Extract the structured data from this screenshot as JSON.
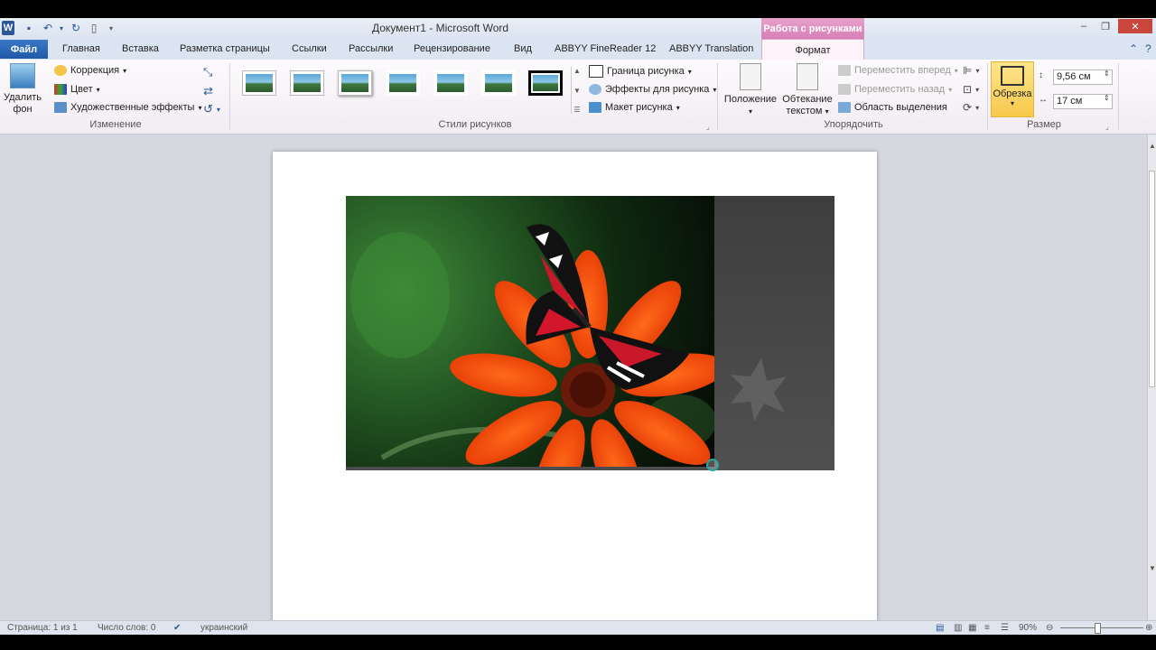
{
  "titlebar": {
    "title": "Документ1 - Microsoft Word",
    "context_group": "Работа с рисунками",
    "word_icon": "W"
  },
  "tabs": {
    "file": "Файл",
    "home": "Главная",
    "insert": "Вставка",
    "layout": "Разметка страницы",
    "references": "Ссылки",
    "mailings": "Рассылки",
    "review": "Рецензирование",
    "view": "Вид",
    "abbyy_fr": "ABBYY FineReader 12",
    "abbyy_tr": "ABBYY Translation",
    "format": "Формат"
  },
  "ribbon": {
    "remove_bg_line1": "Удалить",
    "remove_bg_line2": "фон",
    "correction": "Коррекция",
    "color": "Цвет",
    "artistic": "Художественные эффекты",
    "group_adjust": "Изменение",
    "group_styles": "Стили рисунков",
    "border": "Граница рисунка",
    "effects": "Эффекты для рисунка",
    "layout": "Макет рисунка",
    "position_line1": "Положение",
    "wrap_line1": "Обтекание",
    "wrap_line2": "текстом",
    "bring_forward": "Переместить вперед",
    "send_back": "Переместить назад",
    "selection_pane": "Область выделения",
    "group_arrange": "Упорядочить",
    "crop": "Обрезка",
    "height": "9,56 см",
    "width": "17 см",
    "group_size": "Размер"
  },
  "status": {
    "page": "Страница: 1 из 1",
    "words": "Число слов: 0",
    "language": "украинский",
    "zoom": "90%"
  },
  "colors": {
    "file_tab": "#1e5aa8",
    "context_tab": "#d77fb6",
    "crop_active": "#f8c94c"
  }
}
